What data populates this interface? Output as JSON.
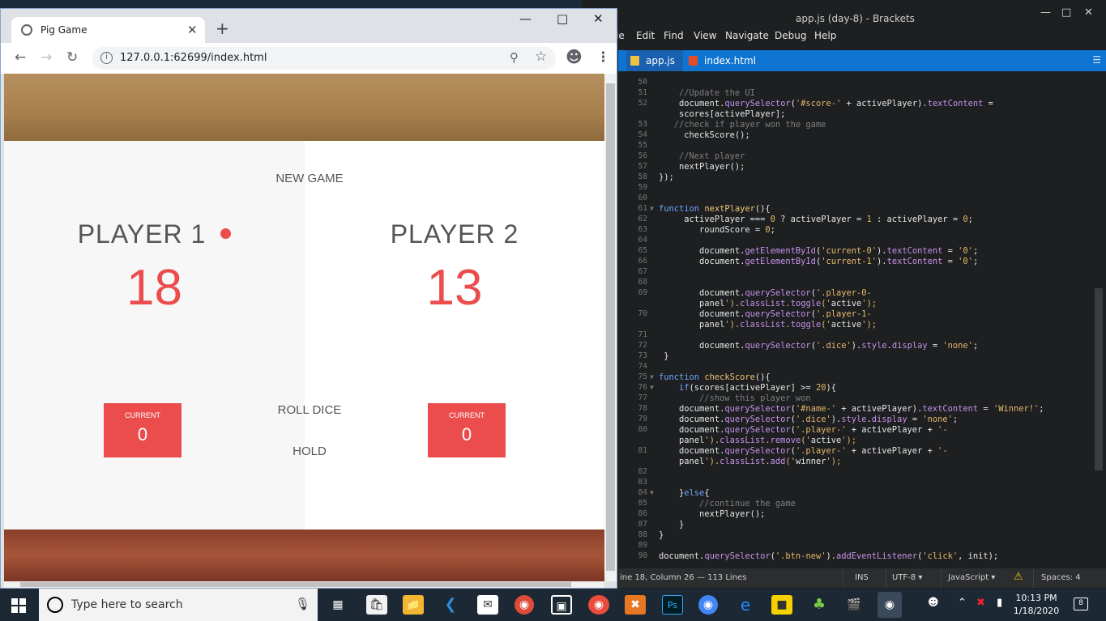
{
  "brackets": {
    "title": "app.js (day-8) - Brackets",
    "menu": [
      "le",
      "Edit",
      "Find",
      "View",
      "Navigate",
      "Debug",
      "Help"
    ],
    "tabs": [
      {
        "label": "app.js"
      },
      {
        "label": "index.html"
      }
    ],
    "status": {
      "position": "ine 18, Column 26 — 113 Lines",
      "mode": "INS",
      "encoding": "UTF-8 ▾",
      "language": "JavaScript ▾",
      "spaces": "Spaces: 4"
    },
    "code": [
      {
        "n": "50",
        "t": ""
      },
      {
        "n": "51",
        "t": "    //Update the UI"
      },
      {
        "n": "52",
        "t": "    document.querySelector('#score-' + activePlayer).textContent ="
      },
      {
        "n": "",
        "t": "    scores[activePlayer];"
      },
      {
        "n": "53",
        "t": "   //check if player won the game"
      },
      {
        "n": "54",
        "t": "     checkScore();"
      },
      {
        "n": "55",
        "t": ""
      },
      {
        "n": "56",
        "t": "    //Next player"
      },
      {
        "n": "57",
        "t": "    nextPlayer();"
      },
      {
        "n": "58",
        "t": "});"
      },
      {
        "n": "59",
        "t": ""
      },
      {
        "n": "60",
        "t": ""
      },
      {
        "n": "61",
        "t": "function nextPlayer(){"
      },
      {
        "n": "62",
        "t": "     activePlayer === 0 ? activePlayer = 1 : activePlayer = 0;"
      },
      {
        "n": "63",
        "t": "        roundScore = 0;"
      },
      {
        "n": "64",
        "t": ""
      },
      {
        "n": "65",
        "t": "        document.getElementById('current-0').textContent = '0';"
      },
      {
        "n": "66",
        "t": "        document.getElementById('current-1').textContent = '0';"
      },
      {
        "n": "67",
        "t": ""
      },
      {
        "n": "68",
        "t": ""
      },
      {
        "n": "69",
        "t": "        document.querySelector('.player-0-"
      },
      {
        "n": "",
        "t": "        panel').classList.toggle('active');"
      },
      {
        "n": "70",
        "t": "        document.querySelector('.player-1-"
      },
      {
        "n": "",
        "t": "        panel').classList.toggle('active');"
      },
      {
        "n": "71",
        "t": ""
      },
      {
        "n": "72",
        "t": "        document.querySelector('.dice').style.display = 'none';"
      },
      {
        "n": "73",
        "t": " }"
      },
      {
        "n": "74",
        "t": ""
      },
      {
        "n": "75",
        "t": "function checkScore(){"
      },
      {
        "n": "76",
        "t": "    if(scores[activePlayer] >= 20){"
      },
      {
        "n": "77",
        "t": "        //show this player won"
      },
      {
        "n": "78",
        "t": "    document.querySelector('#name-' + activePlayer).textContent = 'Winner!';"
      },
      {
        "n": "79",
        "t": "    document.querySelector('.dice').style.display = 'none';"
      },
      {
        "n": "80",
        "t": "    document.querySelector('.player-' + activePlayer + '-"
      },
      {
        "n": "",
        "t": "    panel').classList.remove('active');"
      },
      {
        "n": "81",
        "t": "    document.querySelector('.player-' + activePlayer + '-"
      },
      {
        "n": "",
        "t": "    panel').classList.add('winner');"
      },
      {
        "n": "82",
        "t": ""
      },
      {
        "n": "83",
        "t": ""
      },
      {
        "n": "84",
        "t": "    }else{"
      },
      {
        "n": "85",
        "t": "        //continue the game"
      },
      {
        "n": "86",
        "t": "        nextPlayer();"
      },
      {
        "n": "87",
        "t": "    }"
      },
      {
        "n": "88",
        "t": "}"
      },
      {
        "n": "89",
        "t": ""
      },
      {
        "n": "90",
        "t": "document.querySelector('.btn-new').addEventListener('click', init);"
      }
    ]
  },
  "chrome": {
    "tab_title": "Pig Game",
    "url": "127.0.0.1:62699/index.html"
  },
  "game": {
    "new_game": "NEW GAME",
    "roll_dice": "ROLL DICE",
    "hold": "HOLD",
    "player1": {
      "name": "PLAYER 1",
      "score": "18",
      "current_label": "CURRENT",
      "current": "0"
    },
    "player2": {
      "name": "PLAYER 2",
      "score": "13",
      "current_label": "CURRENT",
      "current": "0"
    }
  },
  "taskbar": {
    "search_placeholder": "Type here to search",
    "time": "10:13 PM",
    "date": "1/18/2020",
    "notifications": "8"
  },
  "colors": {
    "accent": "#eb4d4d",
    "brackets_tab": "#0d74d1"
  }
}
